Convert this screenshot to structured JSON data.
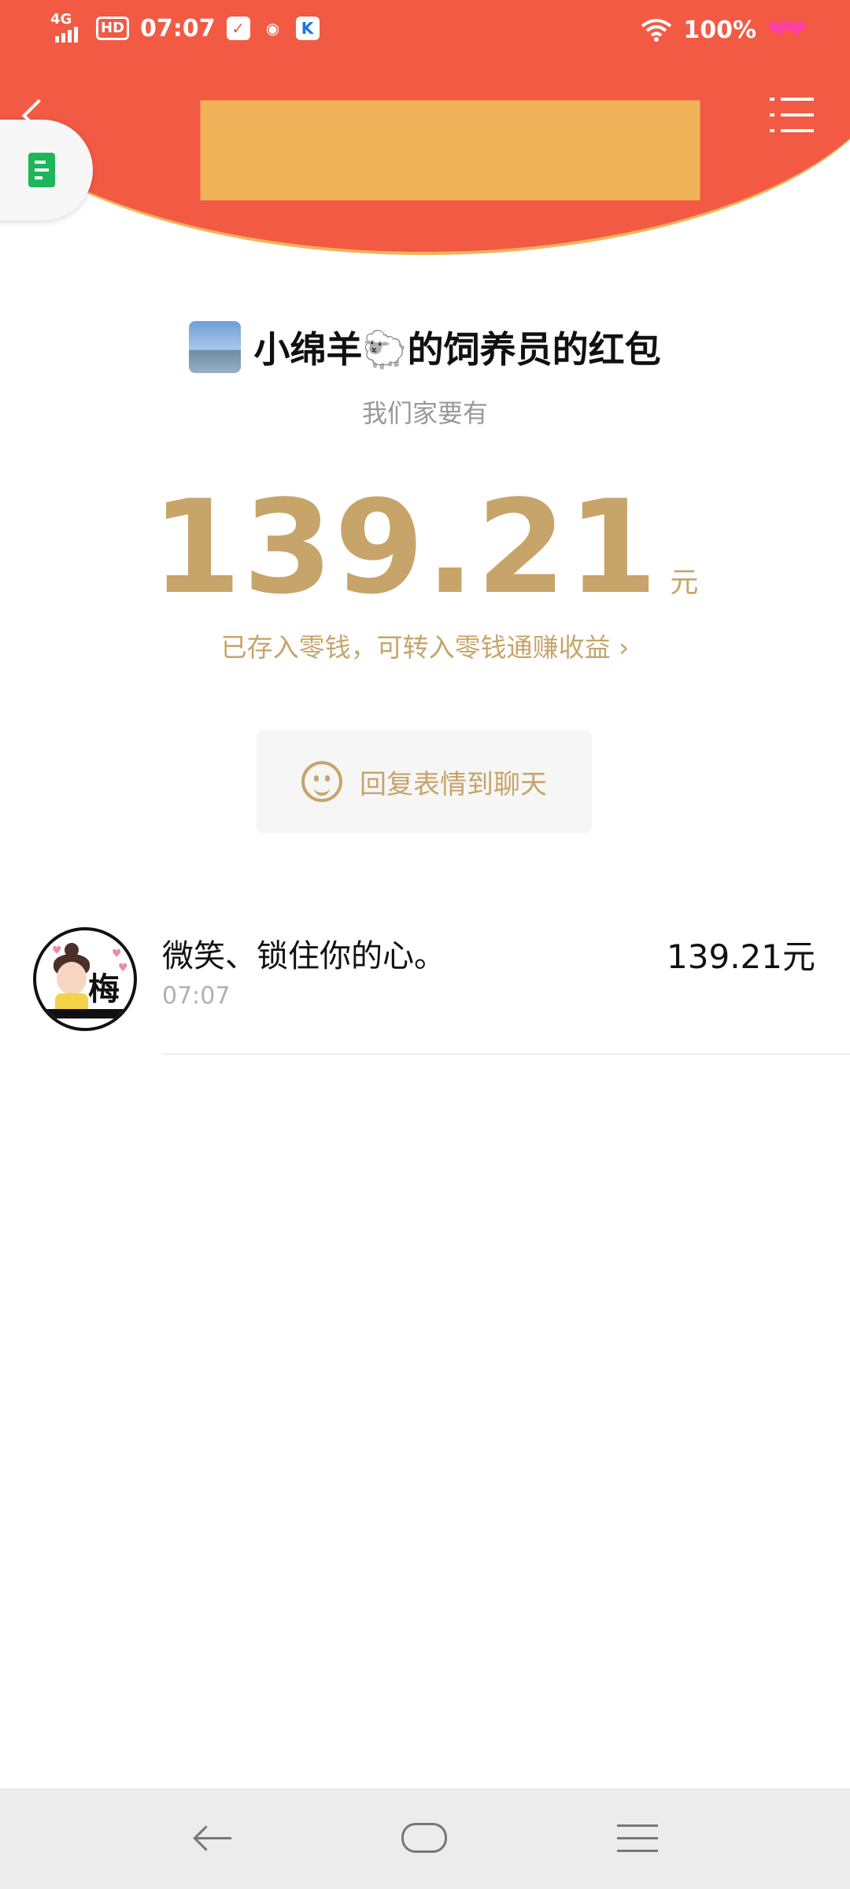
{
  "status_bar": {
    "network": "4G",
    "hd": "HD",
    "time": "07:07",
    "battery": "100%",
    "icons": [
      "signal-icon",
      "check-icon",
      "qq-icon",
      "app-icon",
      "wifi-icon",
      "hearts-icon"
    ]
  },
  "header": {
    "back_icon": "back-icon",
    "menu_icon": "list-menu-icon",
    "floating_window_icon": "document-icon"
  },
  "envelope": {
    "sender_name": "小绵羊🐑的饲养员的红包",
    "message": "我们家要有",
    "amount": "139.21",
    "unit": "元",
    "wallet_link": "已存入零钱，可转入零钱通赚收益",
    "wallet_link_arrow": "›"
  },
  "reply_button": {
    "label": "回复表情到聊天",
    "icon": "smile-icon"
  },
  "records": [
    {
      "avatar_char": "梅",
      "name": "微笑、锁住你的心。",
      "time": "07:07",
      "amount": "139.21元"
    }
  ],
  "nav": {
    "icons": [
      "back-icon",
      "home-icon",
      "menu-icon"
    ]
  },
  "colors": {
    "header_red": "#f25a44",
    "gold": "#c7a46a",
    "header_edge": "#f1b35a"
  }
}
